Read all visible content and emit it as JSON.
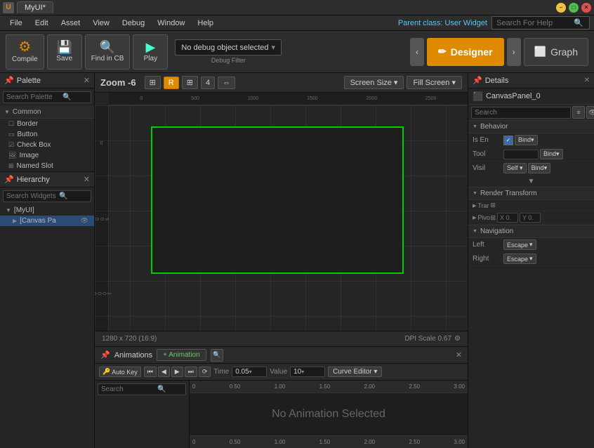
{
  "titlebar": {
    "icon": "U",
    "tab": "MyUI*",
    "btn_min": "−",
    "btn_max": "□",
    "btn_close": "✕"
  },
  "menubar": {
    "items": [
      "File",
      "Edit",
      "Asset",
      "View",
      "Debug",
      "Window",
      "Help"
    ],
    "parent_class_label": "Parent class:",
    "parent_class_value": "User Widget",
    "search_placeholder": "Search For Help"
  },
  "toolbar": {
    "compile": "Compile",
    "save": "Save",
    "find_in_cb": "Find in CB",
    "play": "Play",
    "debug_label": "Debug Filter",
    "debug_value": "No debug object selected",
    "designer": "Designer",
    "graph": "Graph"
  },
  "palette": {
    "title": "Palette",
    "search_placeholder": "Search Palette",
    "section_common": "Common",
    "items": [
      "Border",
      "Button",
      "Check Box",
      "Image",
      "Named Slot"
    ]
  },
  "hierarchy": {
    "title": "Hierarchy",
    "search_placeholder": "Search Widgets",
    "root": "[MyUI]",
    "child": "[Canvas Pa"
  },
  "canvas": {
    "zoom_label": "Zoom -6",
    "btn_r": "R",
    "btn_4": "4",
    "screen_size": "Screen Size ▾",
    "fill_screen": "Fill Screen ▾",
    "dimension": "1280 x 720 (16:9)",
    "dpi": "DPI Scale 0.67",
    "ruler_h": [
      "0",
      "500",
      "1000",
      "1500",
      "2000",
      "2500"
    ],
    "ruler_v": [
      "0",
      "5",
      "1",
      "1",
      "1"
    ]
  },
  "details": {
    "title": "Details",
    "close": "✕",
    "panel_name": "CanvasPanel_0",
    "search_placeholder": "Search",
    "sections": {
      "behavior": "Behavior",
      "render_transform": "Render Transform",
      "navigation": "Navigation"
    },
    "behavior": {
      "is_enabled_label": "Is En",
      "is_enabled_checked": true,
      "tool_label": "Tool",
      "visibility_label": "Visil",
      "visibility_value": "Self",
      "bind": "Bind▾"
    },
    "render_transform": {
      "translation_label": "Trar",
      "pivot_label": "Pivo",
      "x_value": "X 0.",
      "y_value": "Y 0."
    },
    "navigation": {
      "left_label": "Left",
      "left_value": "Escape",
      "right_label": "Right",
      "right_value": "Escape"
    }
  },
  "animation": {
    "title": "Animations",
    "add_btn": "+ Animation",
    "toolbar": {
      "auto_key": "Auto Key",
      "time_label": "Time",
      "time_value": "0.05",
      "value_label": "Value",
      "value_value": "10",
      "curve_editor": "Curve Editor",
      "curve_arr": "▾"
    },
    "search_placeholder": "Search",
    "no_anim_text": "No Animation Selected",
    "timeline_marks_top": [
      "0",
      "0.50",
      "1.00",
      "1.50",
      "2.00",
      "2.50",
      "3.00"
    ],
    "timeline_marks_bottom": [
      "0",
      "0.50",
      "1.00",
      "1.50",
      "2.00",
      "2.50",
      "3.00"
    ],
    "transport": [
      "⏮",
      "◀",
      "▶",
      "⏭",
      "⟳"
    ]
  }
}
